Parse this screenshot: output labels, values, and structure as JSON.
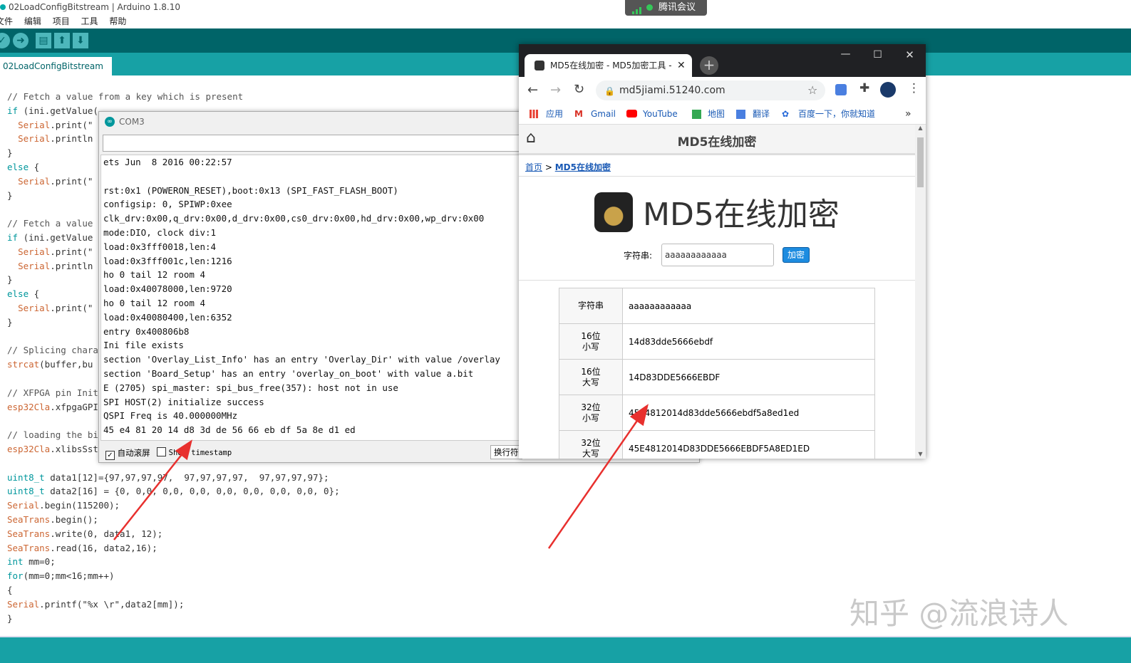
{
  "ide": {
    "window_title": "02LoadConfigBitstream | Arduino 1.8.10",
    "menu": [
      "文件",
      "编辑",
      "项目",
      "工具",
      "帮助"
    ],
    "tab_label": "02LoadConfigBitstream",
    "code_lines": [
      "// Fetch a value from a key which is present",
      "if (ini.getValue(",
      "  Serial.print(\"",
      "  Serial.println",
      "}",
      "else {",
      "  Serial.print(\"",
      "}",
      "",
      "// Fetch a value",
      "if (ini.getValue",
      "  Serial.print(\"",
      "  Serial.println",
      "}",
      "else {",
      "  Serial.print(\"",
      "}",
      "",
      "// Splicing chara",
      "strcat(buffer,bu",
      "",
      "// XFPGA pin Init",
      "esp32Cla.xfpgaGPI",
      "",
      "// loading the bi",
      "esp32Cla.xlibsSst",
      "",
      "uint8_t data1[12]={97,97,97,97,  97,97,97,97,  97,97,97,97};",
      "uint8_t data2[16] = {0, 0,0, 0,0, 0,0, 0,0, 0,0, 0,0, 0,0, 0};",
      "Serial.begin(115200);",
      "SeaTrans.begin();",
      "SeaTrans.write(0, data1, 12);",
      "SeaTrans.read(16, data2,16);",
      "int mm=0;",
      "for(mm=0;mm<16;mm++)",
      "{",
      "Serial.printf(\"%x \\r\",data2[mm]);",
      "}"
    ]
  },
  "meeting": {
    "label": "腾讯会议"
  },
  "serial": {
    "title": "COM3",
    "input_value": "",
    "lines": [
      "ets Jun  8 2016 00:22:57",
      "",
      "rst:0x1 (POWERON_RESET),boot:0x13 (SPI_FAST_FLASH_BOOT)",
      "configsip: 0, SPIWP:0xee",
      "clk_drv:0x00,q_drv:0x00,d_drv:0x00,cs0_drv:0x00,hd_drv:0x00,wp_drv:0x00",
      "mode:DIO, clock div:1",
      "load:0x3fff0018,len:4",
      "load:0x3fff001c,len:1216",
      "ho 0 tail 12 room 4",
      "load:0x40078000,len:9720",
      "ho 0 tail 12 room 4",
      "load:0x40080400,len:6352",
      "entry 0x400806b8",
      "Ini file exists",
      "section 'Overlay_List_Info' has an entry 'Overlay_Dir' with value /overlay",
      "section 'Board_Setup' has an entry 'overlay_on_boot' with value a.bit",
      "E (2705) spi_master: spi_bus_free(357): host not in use",
      "SPI HOST(2) initialize success",
      "QSPI Freq is 40.000000MHz",
      "45 e4 81 20 14 d8 3d de 56 66 eb df 5a 8e d1 ed"
    ],
    "autoscroll_label": "自动滚屏",
    "autoscroll_checked": true,
    "timestamp_label": "Show timestamp",
    "lineending_label": "换行符"
  },
  "browser": {
    "tab_title": "MD5在线加密 - MD5加密工具 -",
    "url": "md5jiami.51240.com",
    "bookmarks": [
      "应用",
      "Gmail",
      "YouTube",
      "地图",
      "翻译",
      "百度一下，你就知道"
    ],
    "site": {
      "header_title": "MD5在线加密",
      "breadcrumb_home": "首页",
      "breadcrumb_sep": ">",
      "breadcrumb_current": "MD5在线加密",
      "logo_text": "MD5在线加密",
      "input_label": "字符串:",
      "input_value": "aaaaaaaaaaaa",
      "encrypt_button": "加密",
      "results": [
        {
          "key": "字符串",
          "key2": "",
          "value": "aaaaaaaaaaaa"
        },
        {
          "key": "16位",
          "key2": "小写",
          "value": "14d83dde5666ebdf"
        },
        {
          "key": "16位",
          "key2": "大写",
          "value": "14D83DDE5666EBDF"
        },
        {
          "key": "32位",
          "key2": "小写",
          "value": "45e4812014d83dde5666ebdf5a8ed1ed"
        },
        {
          "key": "32位",
          "key2": "大写",
          "value": "45E4812014D83DDE5666EBDF5A8ED1ED"
        }
      ]
    }
  },
  "watermark": "知乎 @流浪诗人",
  "colors": {
    "arduino_dark": "#006468",
    "arduino_teal": "#17a1a5",
    "arrow_red": "#e8302e"
  }
}
